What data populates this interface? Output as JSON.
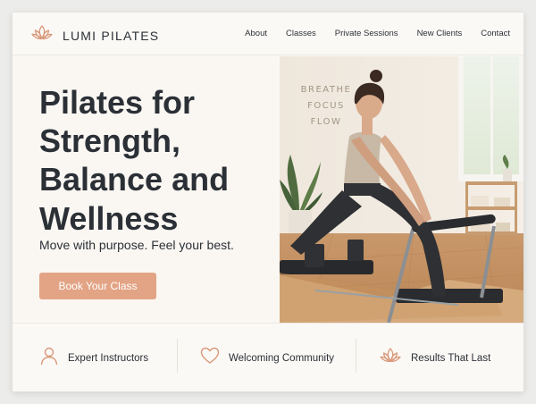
{
  "brand": {
    "name": "LUMI PILATES",
    "logo_icon": "lotus-icon"
  },
  "nav": {
    "items": [
      "About",
      "Classes",
      "Private Sessions",
      "New Clients",
      "Contact"
    ]
  },
  "hero": {
    "title_lines": [
      "Pilates for",
      "Strength,",
      "Balance and",
      "Wellness"
    ],
    "subtitle": "Move with purpose. Feel your best.",
    "cta_label": "Book Your Class",
    "wall_text": [
      "BREATHE",
      "FOCUS",
      "FLOW"
    ]
  },
  "features": [
    {
      "icon": "person-icon",
      "label": "Expert Instructors"
    },
    {
      "icon": "heart-icon",
      "label": "Welcoming Community"
    },
    {
      "icon": "lotus-icon",
      "label": "Results That Last"
    }
  ],
  "colors": {
    "accent": "#e2a485",
    "text": "#2b3036",
    "background": "#fbf9f6"
  }
}
